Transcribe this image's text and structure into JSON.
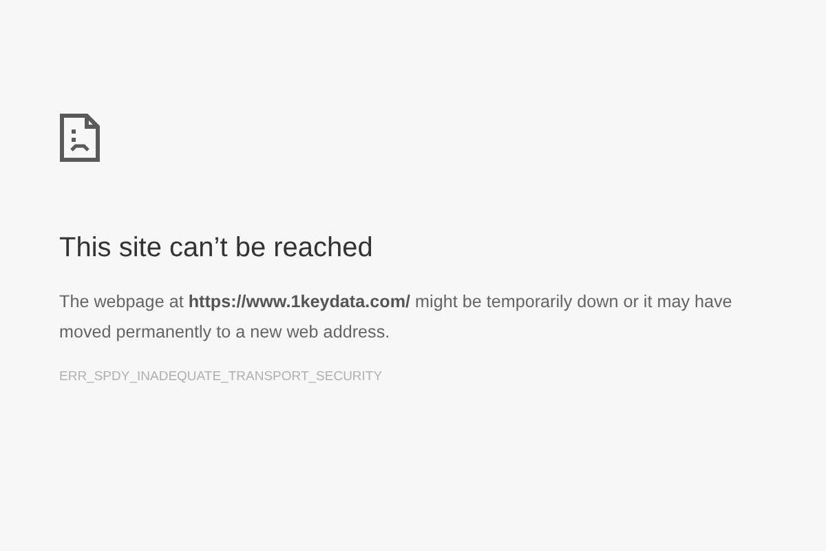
{
  "error_page": {
    "heading": "This site can’t be reached",
    "message": "The webpage at **https://www.1keydata.com/** might be temporarily down or it may have moved permanently to a new web address.",
    "error_code": "ERR_SPDY_INADEQUATE_TRANSPORT_SECURITY"
  }
}
